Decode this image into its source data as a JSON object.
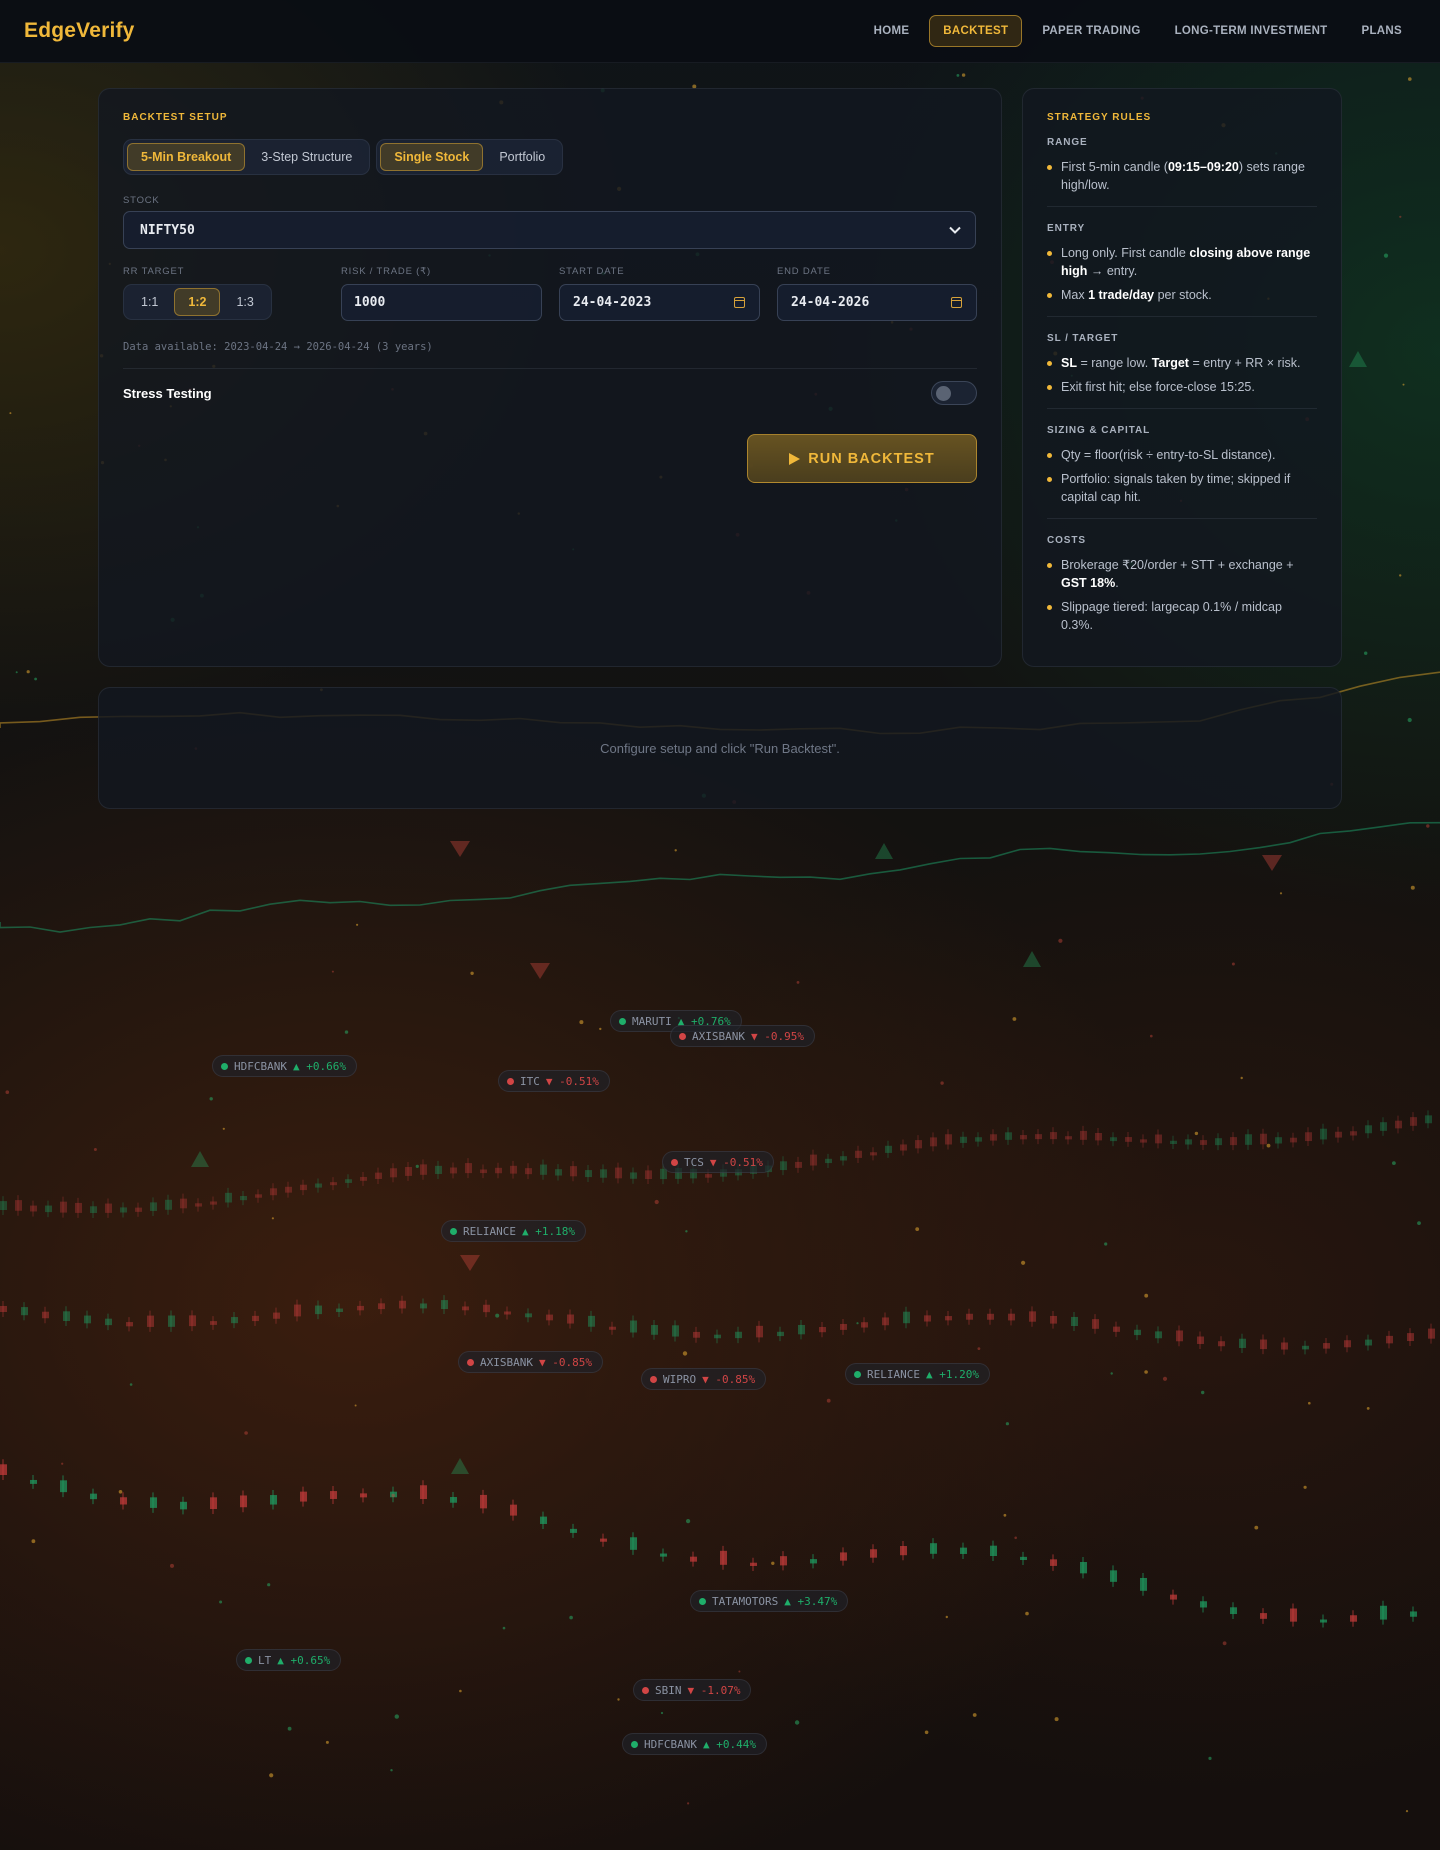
{
  "app": {
    "logo": "EdgeVerify"
  },
  "nav": {
    "links": [
      {
        "label": "HOME",
        "active": false
      },
      {
        "label": "BACKTEST",
        "active": true
      },
      {
        "label": "PAPER TRADING",
        "active": false
      },
      {
        "label": "LONG-TERM INVESTMENT",
        "active": false
      },
      {
        "label": "PLANS",
        "active": false
      }
    ]
  },
  "setup": {
    "title": "BACKTEST SETUP",
    "strategy_options": [
      {
        "label": "5-Min Breakout",
        "active": true
      },
      {
        "label": "3-Step Structure",
        "active": false
      }
    ],
    "mode_options": [
      {
        "label": "Single Stock",
        "active": true
      },
      {
        "label": "Portfolio",
        "active": false
      }
    ],
    "stock_label": "STOCK",
    "stock_value": "NIFTY50",
    "rr_label": "RR TARGET",
    "rr_options": [
      {
        "label": "1:1",
        "active": false
      },
      {
        "label": "1:2",
        "active": true
      },
      {
        "label": "1:3",
        "active": false
      }
    ],
    "risk_label": "RISK / TRADE (₹)",
    "risk_value": "1000",
    "start_label": "START DATE",
    "start_value": "24-04-2023",
    "end_label": "END DATE",
    "end_value": "24-04-2026",
    "data_available": "Data available: 2023-04-24 → 2026-04-24 (3 years)",
    "stress_label": "Stress Testing",
    "stress_enabled": false,
    "run_label": "RUN BACKTEST",
    "run_icon": "play-icon"
  },
  "rules": {
    "title": "STRATEGY RULES",
    "sections": [
      {
        "heading": "RANGE",
        "items": [
          [
            {
              "t": "First 5-min candle ("
            },
            {
              "t": "09:15–09:20",
              "b": true
            },
            {
              "t": ") sets range high/low."
            }
          ]
        ]
      },
      {
        "heading": "ENTRY",
        "items": [
          [
            {
              "t": "Long only. First candle "
            },
            {
              "t": "closing above range high",
              "b": true
            },
            {
              "t": " → entry."
            }
          ],
          [
            {
              "t": "Max "
            },
            {
              "t": "1 trade/day",
              "b": true
            },
            {
              "t": " per stock."
            }
          ]
        ]
      },
      {
        "heading": "SL / TARGET",
        "items": [
          [
            {
              "t": "SL",
              "b": true
            },
            {
              "t": " = range low. "
            },
            {
              "t": "Target",
              "b": true
            },
            {
              "t": " = entry + RR × risk."
            }
          ],
          [
            {
              "t": "Exit first hit; else force-close 15:25."
            }
          ]
        ]
      },
      {
        "heading": "SIZING & CAPITAL",
        "items": [
          [
            {
              "t": "Qty = floor(risk ÷ entry-to-SL distance)."
            }
          ],
          [
            {
              "t": "Portfolio: signals taken by time; skipped if capital cap hit."
            }
          ]
        ]
      },
      {
        "heading": "COSTS",
        "items": [
          [
            {
              "t": "Brokerage ₹20/order + STT + exchange + "
            },
            {
              "t": "GST 18%",
              "b": true
            },
            {
              "t": "."
            }
          ],
          [
            {
              "t": "Slippage tiered: largecap 0.1% / midcap 0.3%."
            }
          ]
        ]
      }
    ]
  },
  "results": {
    "empty_message": "Configure setup and click \"Run Backtest\"."
  },
  "background_tickers": [
    {
      "symbol": "MARUTI",
      "change": "▲ +0.76%",
      "dir": "up"
    },
    {
      "symbol": "AXISBANK",
      "change": "▼ -0.95%",
      "dir": "down"
    },
    {
      "symbol": "HDFCBANK",
      "change": "▲ +0.66%",
      "dir": "up"
    },
    {
      "symbol": "ITC",
      "change": "▼ -0.51%",
      "dir": "down"
    },
    {
      "symbol": "TCS",
      "change": "▼ -0.51%",
      "dir": "down"
    },
    {
      "symbol": "RELIANCE",
      "change": "▲ +1.18%",
      "dir": "up"
    },
    {
      "symbol": "AXISBANK",
      "change": "▼ -0.85%",
      "dir": "down"
    },
    {
      "symbol": "WIPRO",
      "change": "▼ -0.85%",
      "dir": "down"
    },
    {
      "symbol": "RELIANCE",
      "change": "▲ +1.20%",
      "dir": "up"
    },
    {
      "symbol": "TATAMOTORS",
      "change": "▲ +3.47%",
      "dir": "up"
    },
    {
      "symbol": "LT",
      "change": "▲ +0.65%",
      "dir": "up"
    },
    {
      "symbol": "SBIN",
      "change": "▼ -1.07%",
      "dir": "down"
    },
    {
      "symbol": "HDFCBANK",
      "change": "▲ +0.44%",
      "dir": "up"
    }
  ],
  "colors": {
    "accent": "#f0b83a",
    "up": "#1fae6a",
    "down": "#d14545",
    "panel": "#121720"
  }
}
